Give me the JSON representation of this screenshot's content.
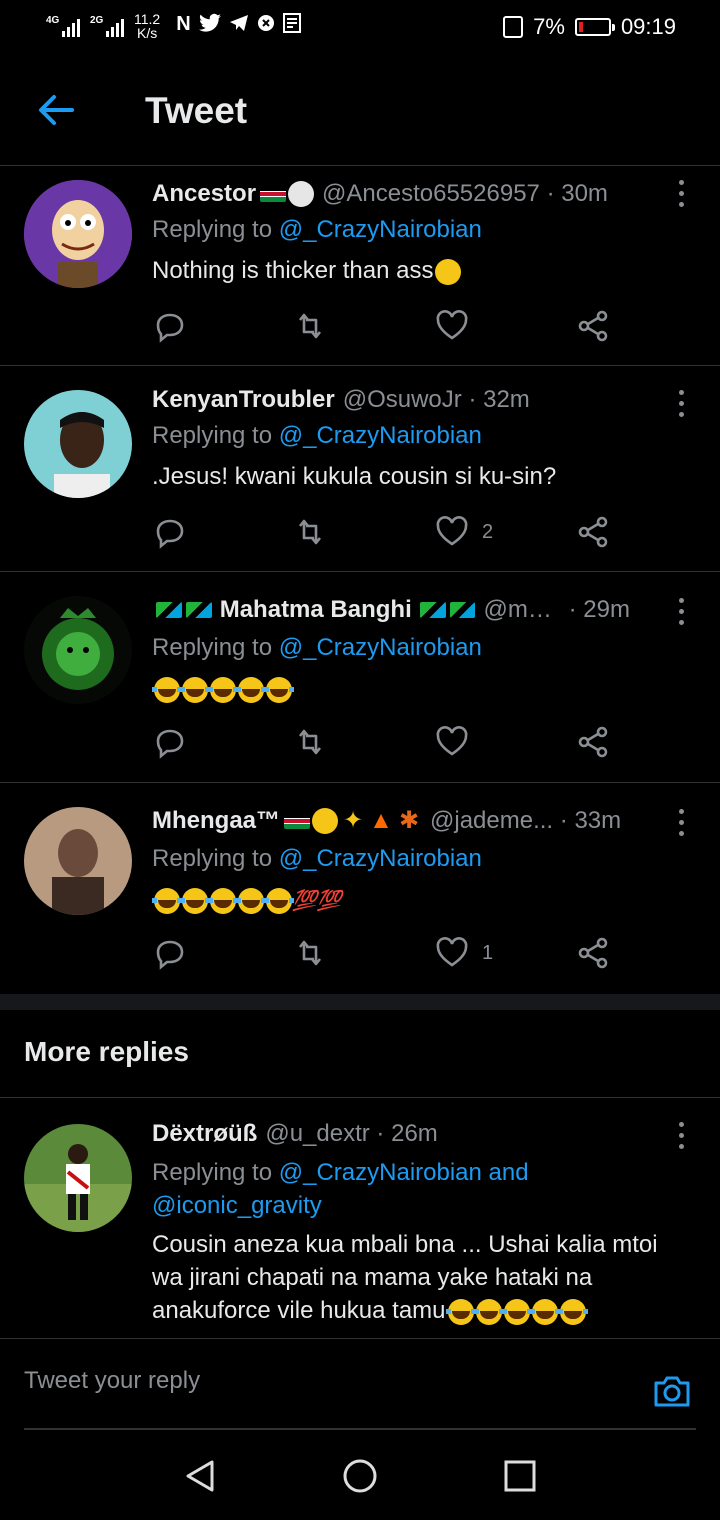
{
  "status_bar": {
    "net1": "4G",
    "net2": "2G",
    "speed_value": "11.2",
    "speed_unit": "K/s",
    "battery": "7%",
    "time": "09:19",
    "icons": [
      "netflix-icon",
      "twitter-icon",
      "telegram-icon",
      "security-icon",
      "news-icon"
    ]
  },
  "header": {
    "title": "Tweet"
  },
  "tweets": [
    {
      "name": "Ancestor",
      "handle": "@Ancesto65526957",
      "time": "30m",
      "reply_prefix": "Replying to",
      "reply_to": "@_CrazyNairobian",
      "text": "Nothing is thicker than ass",
      "likes": "",
      "avatar_color": "#7b3fa0"
    },
    {
      "name": "KenyanTroubler",
      "handle": "@OsuwoJr",
      "time": "32m",
      "reply_prefix": "Replying to",
      "reply_to": "@_CrazyNairobian",
      "text": ".Jesus!  kwani kukula cousin si ku-sin?",
      "likes": "2",
      "avatar_color": "#6fc7c9"
    },
    {
      "name": "Mahatma Banghi",
      "handle": "@mah...",
      "time": "29m",
      "reply_prefix": "Replying to",
      "reply_to": "@_CrazyNairobian",
      "text": "",
      "likes": "",
      "avatar_color": "#0b1f0b"
    },
    {
      "name": "Mhengaa™",
      "handle": "@jademe...",
      "time": "33m",
      "reply_prefix": "Replying to",
      "reply_to": "@_CrazyNairobian",
      "text": "",
      "hundred": "💯💯",
      "likes": "1",
      "avatar_color": "#8a7060"
    }
  ],
  "more_replies": {
    "title": "More replies",
    "tweet": {
      "name": "Dëxtrøüß",
      "handle": "@u_dextr",
      "time": "26m",
      "reply_prefix": "Replying to",
      "reply_to": "@_CrazyNairobian and",
      "reply_to2": "@iconic_gravity",
      "text": "Cousin aneza kua mbali bna ... Ushai kalia mtoi wa jirani chapati na mama yake hataki na anakuforce vile hukua tamu"
    }
  },
  "composer": {
    "placeholder": "Tweet your reply"
  },
  "colors": {
    "accent": "#1d9bf0",
    "muted": "#8b8f94",
    "divider": "#2f3336"
  }
}
